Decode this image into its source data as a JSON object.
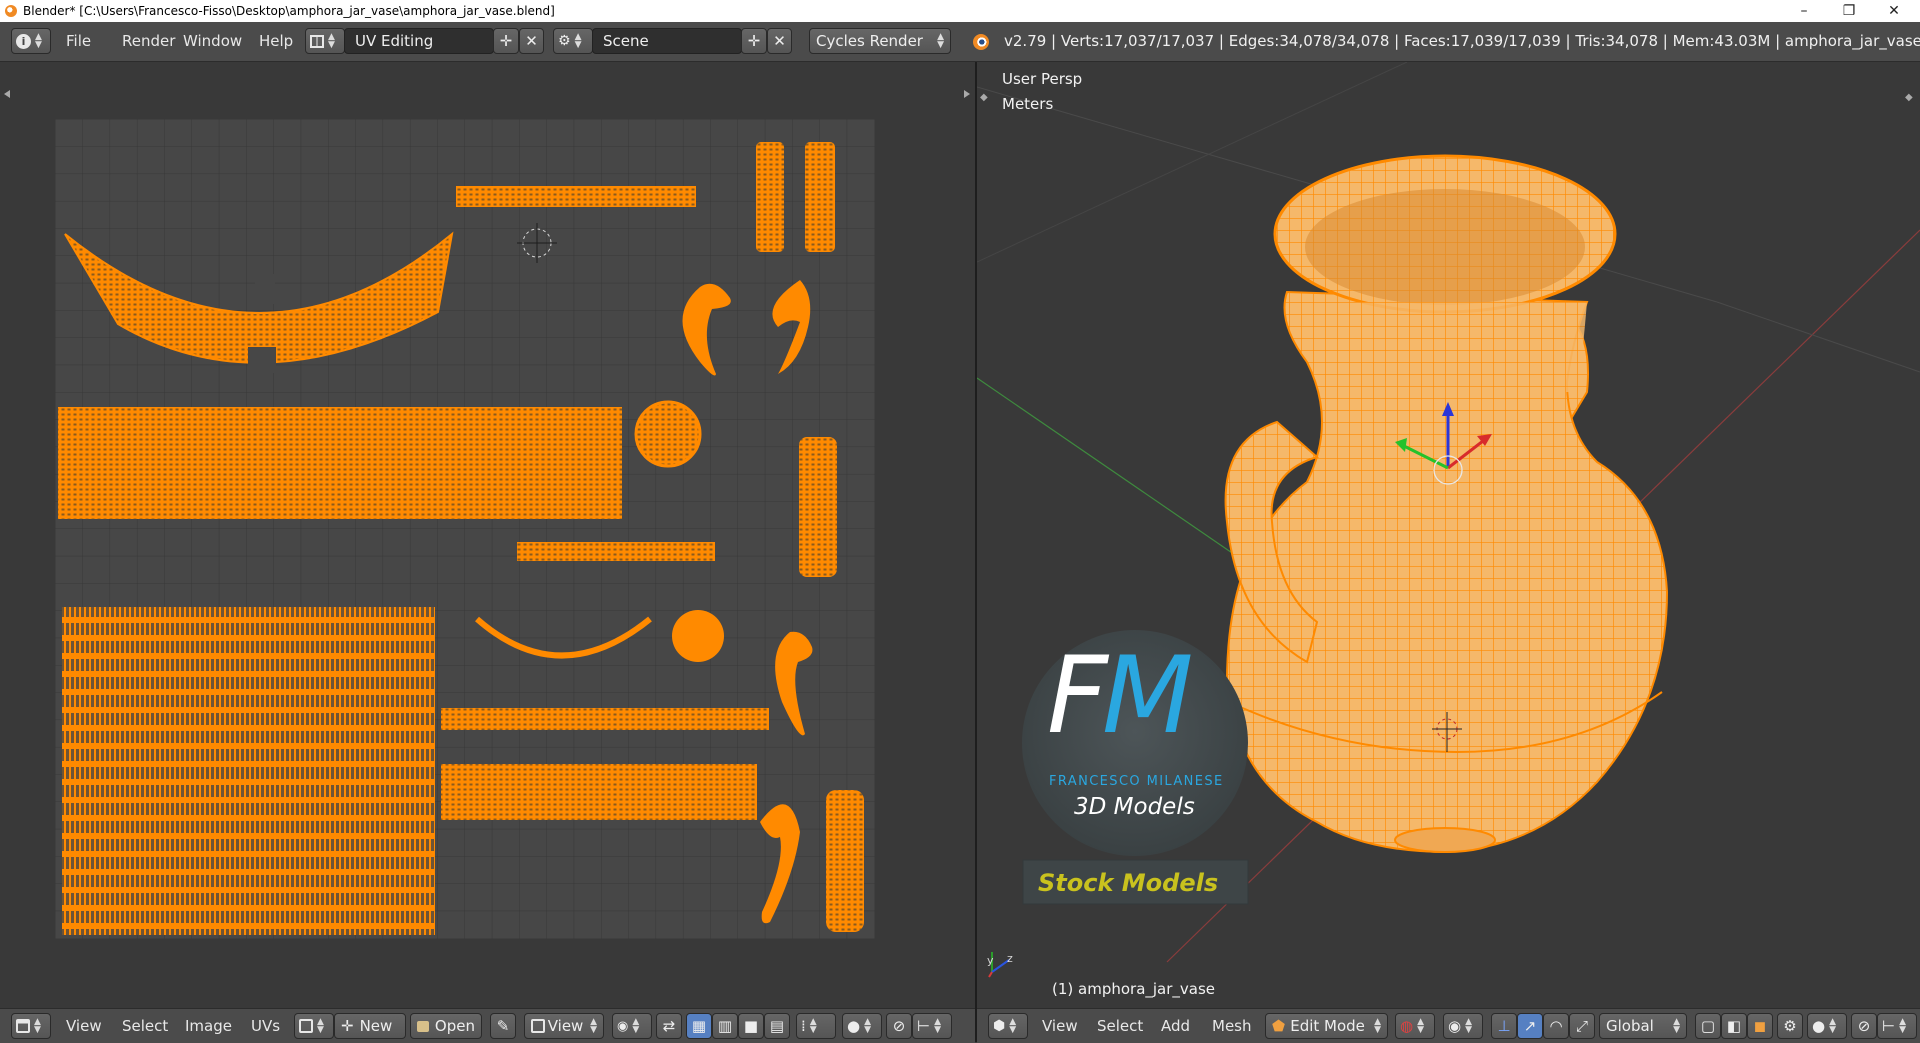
{
  "window": {
    "title": "Blender* [C:\\Users\\Francesco-Fisso\\Desktop\\amphora_jar_vase\\amphora_jar_vase.blend]",
    "minimize_glyph": "–",
    "maximize_glyph": "❐",
    "close_glyph": "✕"
  },
  "info_header": {
    "menus": [
      "File",
      "Render",
      "Window",
      "Help"
    ],
    "screen_layout": "UV Editing",
    "scene": "Scene",
    "render_engine": "Cycles Render",
    "stats": "v2.79 | Verts:17,037/17,037 | Edges:34,078/34,078 | Faces:17,039/17,039 | Tris:34,078 | Mem:43.03M | amphora_jar_vase"
  },
  "uv_editor": {
    "header_menus": [
      "View",
      "Select",
      "Image",
      "UVs"
    ],
    "new_button": "New",
    "open_button": "Open",
    "view_dropdown": "View"
  },
  "viewport": {
    "view_name": "User Persp",
    "units": "Meters",
    "object_label": "(1) amphora_jar_vase",
    "header_menus": [
      "View",
      "Select",
      "Add",
      "Mesh"
    ],
    "mode": "Edit Mode",
    "orientation": "Global"
  },
  "watermark": {
    "monogram": "FM",
    "author": "FRANCESCO MILANESE",
    "tagline": "3D Models",
    "banner": "Stock Models"
  },
  "colors": {
    "uv_orange": "#ff8a00",
    "header_bg": "#4b4b4b",
    "editor_bg": "#393939",
    "uv_grid_bg": "#474747",
    "watermark_blue": "#2aa7e0",
    "watermark_yellow": "#c9c21e"
  },
  "icons": [
    "info-editor-icon",
    "screen-layout-icon",
    "scene-icon",
    "blender-logo-icon",
    "image-editor-icon",
    "view3d-editor-icon",
    "mesh-object-icon",
    "cursor-icon",
    "manipulator-icon"
  ]
}
